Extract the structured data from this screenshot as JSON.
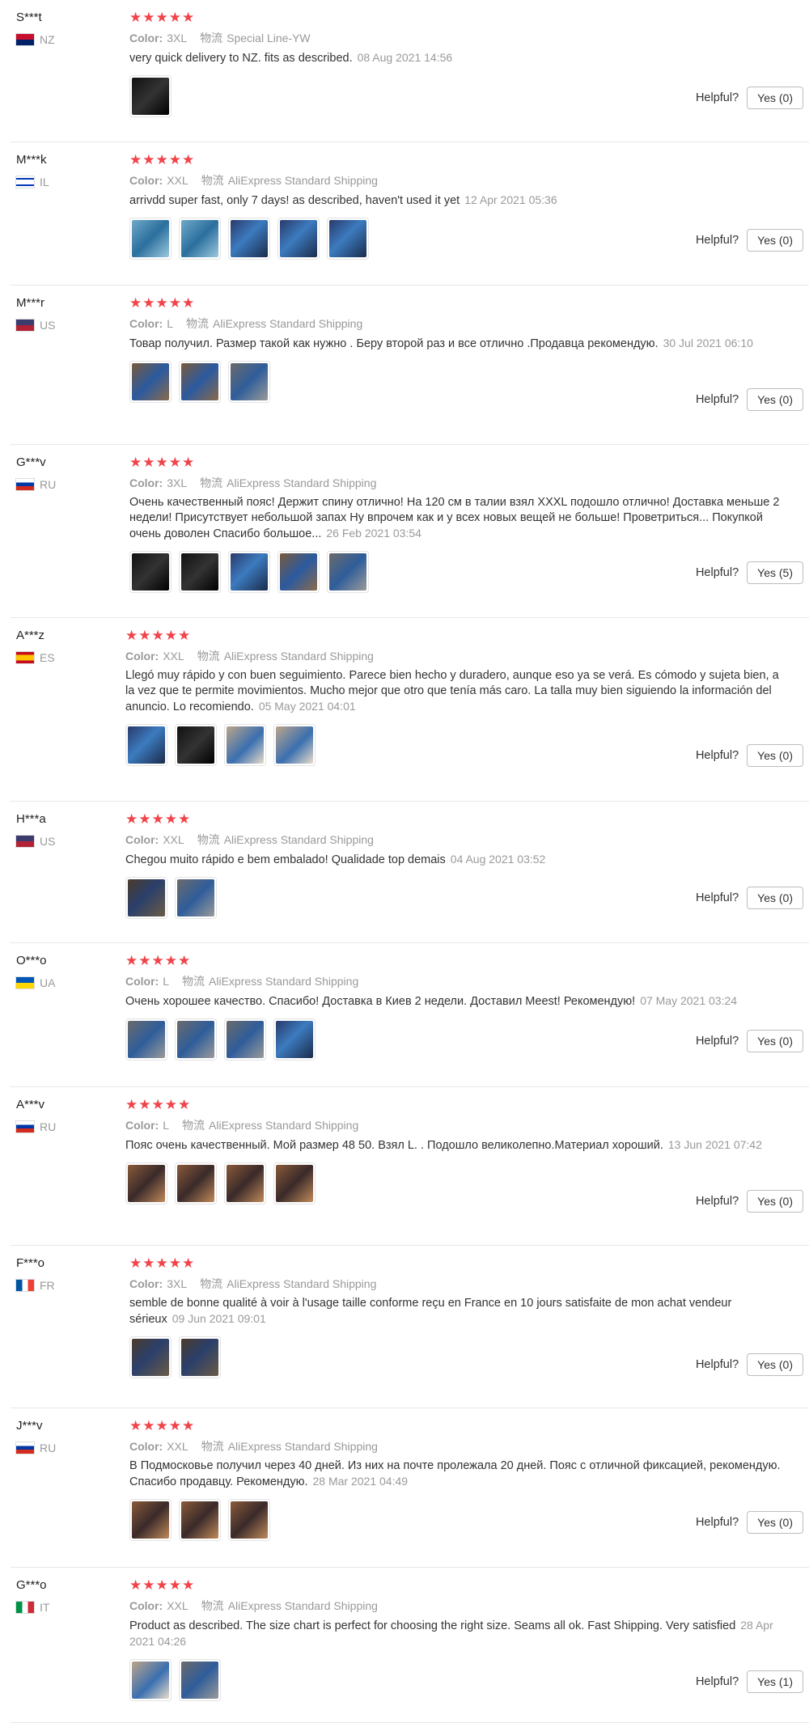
{
  "helpful_label": "Helpful?",
  "color_label": "Color:",
  "shipping_label": "物流",
  "stars": "★★★★★",
  "reviews": [
    {
      "user": "S***t",
      "country": "NZ",
      "flag": [
        "#012169",
        "#c8102e"
      ],
      "color": "3XL",
      "shipping": "Special Line-YW",
      "text": "very quick delivery to NZ. fits as described.",
      "date": "08 Aug 2021 14:56",
      "helpful": "Yes (0)",
      "thumbs": [
        "p5"
      ]
    },
    {
      "user": "M***k",
      "country": "IL",
      "flag": [
        "#ffffff",
        "#0038b8"
      ],
      "color": "XXL",
      "shipping": "AliExpress Standard Shipping",
      "text": "arrivdd super fast, only 7 days! as described, haven't used it yet",
      "date": "12 Apr 2021 05:36",
      "helpful": "Yes (0)",
      "thumbs": [
        "p2",
        "p2",
        "p3",
        "p3",
        "p3"
      ]
    },
    {
      "user": "M***r",
      "country": "US",
      "flag": [
        "#b22234",
        "#3c3b6e"
      ],
      "color": "L",
      "shipping": "AliExpress Standard Shipping",
      "text": "Товар получил. Размер такой как нужно . Беру второй раз и все отлично .Продавца рекомендую.",
      "date": "30 Jul 2021 06:10",
      "helpful": "Yes (0)",
      "thumbs": [
        "p4",
        "p4",
        "p7"
      ]
    },
    {
      "user": "G***v",
      "country": "RU",
      "flag": [
        "#ffffff",
        "#0039a6"
      ],
      "color": "3XL",
      "shipping": "AliExpress Standard Shipping",
      "text": "Очень качественный пояс! Держит спину отлично! На 120 см в талии взял XXXL подошло отлично! Доставка меньше 2 недели! Присутствует небольшой запах Ну впрочем как и у всех новых вещей не больше! Проветриться... Покупкой очень доволен Спасибо большое...",
      "date": "26 Feb 2021 03:54",
      "helpful": "Yes (5)",
      "thumbs": [
        "p5",
        "p5",
        "p3",
        "p4",
        "p7"
      ]
    },
    {
      "user": "A***z",
      "country": "ES",
      "flag": [
        "#c60b1e",
        "#ffc400"
      ],
      "color": "XXL",
      "shipping": "AliExpress Standard Shipping",
      "text": "Llegó muy rápido y con buen seguimiento. Parece bien hecho y duradero, aunque eso ya se verá. Es cómodo y sujeta bien, a la vez que te permite movimientos. Mucho mejor que otro que tenía más caro. La talla muy bien siguiendo la información del anuncio. Lo recomiendo.",
      "date": "05 May 2021 04:01",
      "helpful": "Yes (0)",
      "thumbs": [
        "p3",
        "p5",
        "p6",
        "p6"
      ]
    },
    {
      "user": "H***a",
      "country": "US",
      "flag": [
        "#b22234",
        "#3c3b6e"
      ],
      "color": "XXL",
      "shipping": "AliExpress Standard Shipping",
      "text": "Chegou muito rápido e bem embalado! Qualidade top demais",
      "date": "04 Aug 2021 03:52",
      "helpful": "Yes (0)",
      "thumbs": [
        "p1",
        "p7"
      ]
    },
    {
      "user": "O***o",
      "country": "UA",
      "flag": [
        "#0057b7",
        "#ffd700"
      ],
      "color": "L",
      "shipping": "AliExpress Standard Shipping",
      "text": "Очень хорошее качество. Спасибо! Доставка в Киев 2 недели. Доставил Meest! Рекомендую!",
      "date": "07 May 2021 03:24",
      "helpful": "Yes (0)",
      "thumbs": [
        "p7",
        "p7",
        "p7",
        "p3"
      ]
    },
    {
      "user": "A***v",
      "country": "RU",
      "flag": [
        "#ffffff",
        "#0039a6"
      ],
      "color": "L",
      "shipping": "AliExpress Standard Shipping",
      "text": "Пояс очень качественный. Мой размер 48 50. Взял L. . Подошло великолепно.Материал хороший.",
      "date": "13 Jun 2021 07:42",
      "helpful": "Yes (0)",
      "thumbs": [
        "p8",
        "p8",
        "p8",
        "p8"
      ]
    },
    {
      "user": "F***o",
      "country": "FR",
      "flag": [
        "#0055a4",
        "#ef4135"
      ],
      "color": "3XL",
      "shipping": "AliExpress Standard Shipping",
      "text": "semble de bonne qualité à voir à l'usage taille conforme reçu en France en 10 jours satisfaite de mon achat vendeur sérieux",
      "date": "09 Jun 2021 09:01",
      "helpful": "Yes (0)",
      "thumbs": [
        "p1",
        "p1"
      ]
    },
    {
      "user": "J***v",
      "country": "RU",
      "flag": [
        "#ffffff",
        "#0039a6"
      ],
      "color": "XXL",
      "shipping": "AliExpress Standard Shipping",
      "text": "В Подмосковье получил через 40 дней. Из них на почте пролежала 20 дней. Пояс с отличной фиксацией, рекомендую. Спасибо продавцу. Рекомендую.",
      "date": "28 Mar 2021 04:49",
      "helpful": "Yes (0)",
      "thumbs": [
        "p8",
        "p8",
        "p8"
      ]
    },
    {
      "user": "G***o",
      "country": "IT",
      "flag": [
        "#009246",
        "#ce2b37"
      ],
      "color": "XXL",
      "shipping": "AliExpress Standard Shipping",
      "text": "Product as described. The size chart is perfect for choosing the right size. Seams all ok. Fast Shipping. Very satisfied",
      "date": "28 Apr 2021 04:26",
      "helpful": "Yes (1)",
      "thumbs": [
        "p6",
        "p7"
      ]
    }
  ]
}
